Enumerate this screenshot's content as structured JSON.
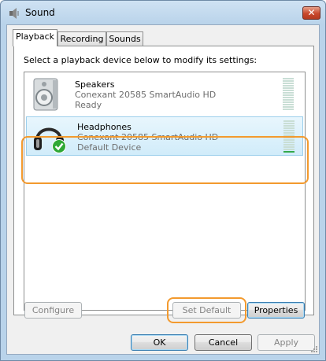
{
  "window": {
    "title": "Sound",
    "close_label": "✕"
  },
  "tabs": [
    {
      "label": "Playback",
      "active": true
    },
    {
      "label": "Recording",
      "active": false
    },
    {
      "label": "Sounds",
      "active": false
    }
  ],
  "playback": {
    "instruction": "Select a playback device below to modify its settings:",
    "devices": [
      {
        "name": "Speakers",
        "driver": "Conexant 20585 SmartAudio HD",
        "status": "Ready",
        "icon": "speaker-icon",
        "selected": false
      },
      {
        "name": "Headphones",
        "driver": "Conexant 20585 SmartAudio HD",
        "status": "Default Device",
        "icon": "headphones-icon",
        "selected": true
      }
    ],
    "buttons": {
      "configure": "Configure",
      "set_default": "Set Default",
      "properties": "Properties"
    }
  },
  "dialog_buttons": {
    "ok": "OK",
    "cancel": "Cancel",
    "apply": "Apply"
  },
  "colors": {
    "highlight": "#f39a2e",
    "selection": "#d1ecfa",
    "check": "#2fa835"
  }
}
